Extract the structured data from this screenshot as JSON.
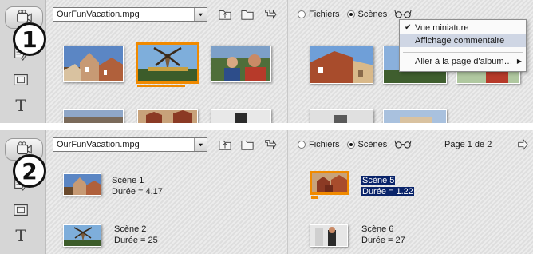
{
  "top": {
    "callout": "1",
    "file_name": "OurFunVacation.mpg",
    "radio_files": "Fichiers",
    "radio_scenes": "Scènes",
    "menu": {
      "items": [
        {
          "label": "Vue miniature",
          "checked": true
        },
        {
          "label": "Affichage commentaire",
          "checked": false
        },
        {
          "label": "Aller à la page d'album…",
          "checked": false,
          "submenu": true
        }
      ]
    }
  },
  "bottom": {
    "callout": "2",
    "file_name": "OurFunVacation.mpg",
    "radio_files": "Fichiers",
    "radio_scenes": "Scènes",
    "page_info": "Page 1 de 2",
    "scenes": [
      {
        "name": "Scène 1",
        "duration": "Durée = 4.17"
      },
      {
        "name": "Scène 2",
        "duration": "Durée = 25"
      },
      {
        "name": "Scène 5",
        "duration": "Durée = 1.22"
      },
      {
        "name": "Scène 6",
        "duration": "Durée = 27"
      }
    ]
  },
  "colors": {
    "accent": "#f08a00",
    "highlight": "#0a246a",
    "panel": "#e2e2e2"
  },
  "icons": {
    "toolbar": [
      "video-scenes-icon",
      "edit-icon",
      "frame-icon",
      "text-title-icon"
    ],
    "file_buttons": [
      "folder-up-icon",
      "folder-icon",
      "arrow-icon"
    ],
    "view": "glasses-icon",
    "next": "next-page-arrow-icon"
  }
}
